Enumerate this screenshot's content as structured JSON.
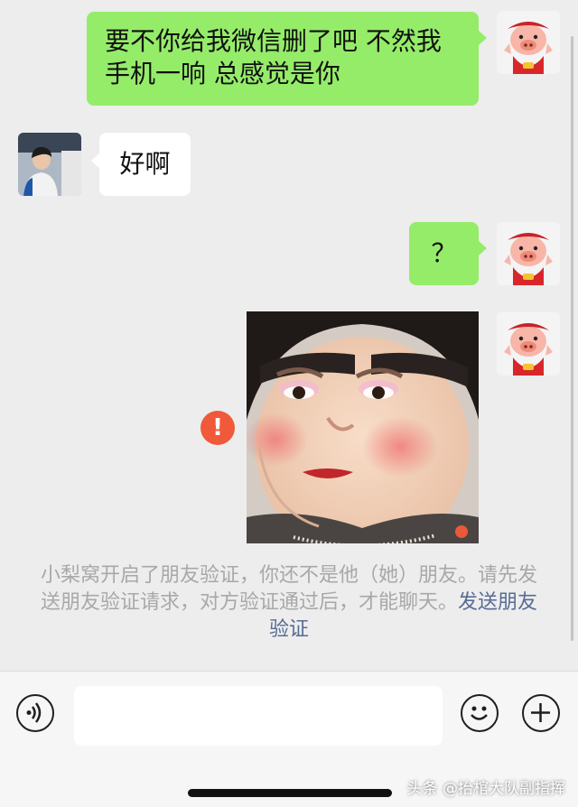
{
  "messages": [
    {
      "side": "right",
      "text": "要不你给我微信删了吧 不然我手机一响 总感觉是你"
    },
    {
      "side": "left",
      "text": "好啊"
    },
    {
      "side": "right",
      "text": "？"
    }
  ],
  "system_notice": {
    "text": "小梨窝开启了朋友验证，你还不是他（她）朋友。请先发送朋友验证请求，对方验证通过后，才能聊天。",
    "link": "发送朋友验证"
  },
  "status": {
    "error_symbol": "!"
  },
  "input": {
    "value": "",
    "placeholder": ""
  },
  "icons": {
    "voice": "voice-icon",
    "emoji": "emoji-icon",
    "more": "plus-icon"
  },
  "watermark": "头条 @抬棺大队副指挥",
  "colors": {
    "background": "#ededed",
    "sent_bubble": "#95ec69",
    "received_bubble": "#ffffff",
    "error": "#f05a3a",
    "link": "#576b95"
  }
}
